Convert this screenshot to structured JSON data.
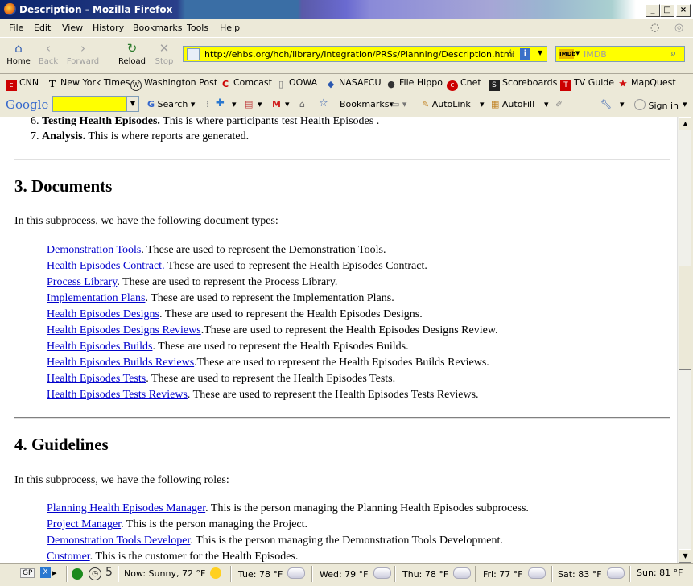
{
  "window": {
    "title": "Description - Mozilla Firefox",
    "controls": [
      "_",
      "□",
      "×"
    ]
  },
  "menu": [
    "File",
    "Edit",
    "View",
    "History",
    "Bookmarks",
    "Tools",
    "Help"
  ],
  "nav": {
    "home": "Home",
    "back": "Back",
    "forward": "Forward",
    "reload": "Reload",
    "stop": "Stop",
    "url": "http://ehbs.org/hch/library/Integration/PRSs/Planning/Description.html",
    "search_placeholder": "IMDB"
  },
  "bookmarks": [
    {
      "label": "CNN",
      "icon": "cnn-icon",
      "glyph": "C"
    },
    {
      "label": "New York Times",
      "icon": "nyt-icon",
      "glyph": "T"
    },
    {
      "label": "Washington Post",
      "icon": "wapo-icon",
      "glyph": "W"
    },
    {
      "label": "Comcast",
      "icon": "comcast-icon",
      "glyph": "C"
    },
    {
      "label": "OOWA",
      "icon": "page-icon",
      "glyph": "▯"
    },
    {
      "label": "NASAFCU",
      "icon": "nasafcu-icon",
      "glyph": "◆"
    },
    {
      "label": "File Hippo",
      "icon": "filehippo-icon",
      "glyph": "●"
    },
    {
      "label": "Cnet",
      "icon": "cnet-icon",
      "glyph": "c"
    },
    {
      "label": "Scoreboards",
      "icon": "scoreboards-icon",
      "glyph": "S"
    },
    {
      "label": "TV Guide",
      "icon": "tvguide-icon",
      "glyph": "T"
    },
    {
      "label": "MapQuest",
      "icon": "mapquest-icon",
      "glyph": "★"
    }
  ],
  "google_bar": {
    "logo": "Google",
    "search": "Search",
    "bookmarks": "Bookmarks",
    "autolink": "AutoLink",
    "autofill": "AutoFill",
    "signin": "Sign in"
  },
  "content": {
    "list_tail": [
      {
        "num": "6.",
        "bold": "Testing Health Episodes.",
        "text": " This is where participants test Health Episodes ."
      },
      {
        "num": "7.",
        "bold": "Analysis.",
        "text": " This is where reports are generated."
      }
    ],
    "documents": {
      "heading": "3. Documents",
      "intro": "In this subprocess, we have the following document types:",
      "items": [
        {
          "link": "Demonstration Tools",
          "text": ". These are used to represent the Demonstration Tools."
        },
        {
          "link": "Health Episodes Contract.",
          "text": " These are used to represent the Health Episodes Contract."
        },
        {
          "link": "Process Library",
          "text": ". These are used to represent the Process Library."
        },
        {
          "link": "Implementation Plans",
          "text": ". These are used to represent the Implementation Plans."
        },
        {
          "link": "Health Episodes Designs",
          "text": ". These are used to represent the Health Episodes Designs."
        },
        {
          "link": "Health Episodes Designs Reviews",
          "text": ".These are used to represent the Health Episodes Designs Review."
        },
        {
          "link": "Health Episodes Builds",
          "text": ". These are used to represent the Health Episodes Builds."
        },
        {
          "link": "Health Episodes Builds Reviews",
          "text": ".These are used to represent the Health Episodes Builds Reviews."
        },
        {
          "link": "Health Episodes Tests",
          "text": ". These are used to represent the Health Episodes Tests."
        },
        {
          "link": "Health Episodes Tests Reviews",
          "text": ". These are used to represent the Health Episodes Tests Reviews."
        }
      ]
    },
    "guidelines": {
      "heading": "4. Guidelines",
      "intro": "In this subprocess, we have the following roles:",
      "items": [
        {
          "link": "Planning Health Episodes Manager",
          "text": ". This is the person managing the Planning Health Episodes subprocess."
        },
        {
          "link": "Project Manager",
          "text": ". This is the person managing the Project."
        },
        {
          "link": "Demonstration Tools Developer",
          "text": ". This is the person managing the Demonstration Tools Development."
        },
        {
          "link": "Customer",
          "text": ". This is the customer for the Health Episodes."
        }
      ]
    }
  },
  "status": {
    "gp": "GP",
    "count": "5",
    "now": "Now: Sunny, 72 °F",
    "forecast": [
      {
        "label": "Tue: 78 °F",
        "icon": "partly-cloudy-icon"
      },
      {
        "label": "Wed: 79 °F",
        "icon": "partly-cloudy-icon"
      },
      {
        "label": "Thu: 78 °F",
        "icon": "partly-cloudy-icon"
      },
      {
        "label": "Fri: 77 °F",
        "icon": "partly-cloudy-icon"
      },
      {
        "label": "Sat: 83 °F",
        "icon": "partly-cloudy-icon"
      },
      {
        "label": "Sun: 81 °F",
        "icon": "partly-cloudy-icon"
      }
    ]
  },
  "colors": {
    "link": "#0000cc",
    "highlight": "#ffff00",
    "chrome": "#ece9d8"
  }
}
